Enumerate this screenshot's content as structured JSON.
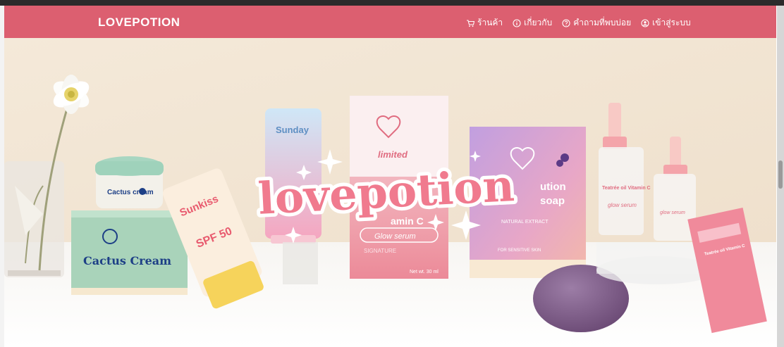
{
  "navbar": {
    "brand": "LOVEPOTION",
    "items": [
      {
        "label": "ร้านค้า",
        "icon": "cart-icon"
      },
      {
        "label": "เกี่ยวกับ",
        "icon": "info-icon"
      },
      {
        "label": "คำถามที่พบบ่อย",
        "icon": "question-icon"
      },
      {
        "label": "เข้าสู่ระบบ",
        "icon": "user-icon"
      }
    ],
    "background": "#dc5f70"
  },
  "hero": {
    "logo_text": "lovepotion",
    "products": {
      "cactus_jar_label": "Cactus cream",
      "cactus_box_label": "Cactus Cream",
      "sunkiss_label": "Sunkiss",
      "sunkiss_spf": "SPF 50",
      "sunday_label": "Sunday",
      "limited_box_label": "limited",
      "serum_box_label": "Glow serum",
      "serum_box_sub": "amin C",
      "signature_label": "SIGNATURE",
      "net_label": "Net wt. 30 ml",
      "soap_box_top": "ution",
      "soap_box_bottom": "soap",
      "natural_extract": "NATURAL EXTRACT",
      "sensitive_skin": "FOR SENSITIVE SKIN",
      "dropper_label": "Teatrée oil Vitamin C",
      "glow_label": "glow serum",
      "small_box_label": "Teatrée oil Vitamin C"
    }
  }
}
